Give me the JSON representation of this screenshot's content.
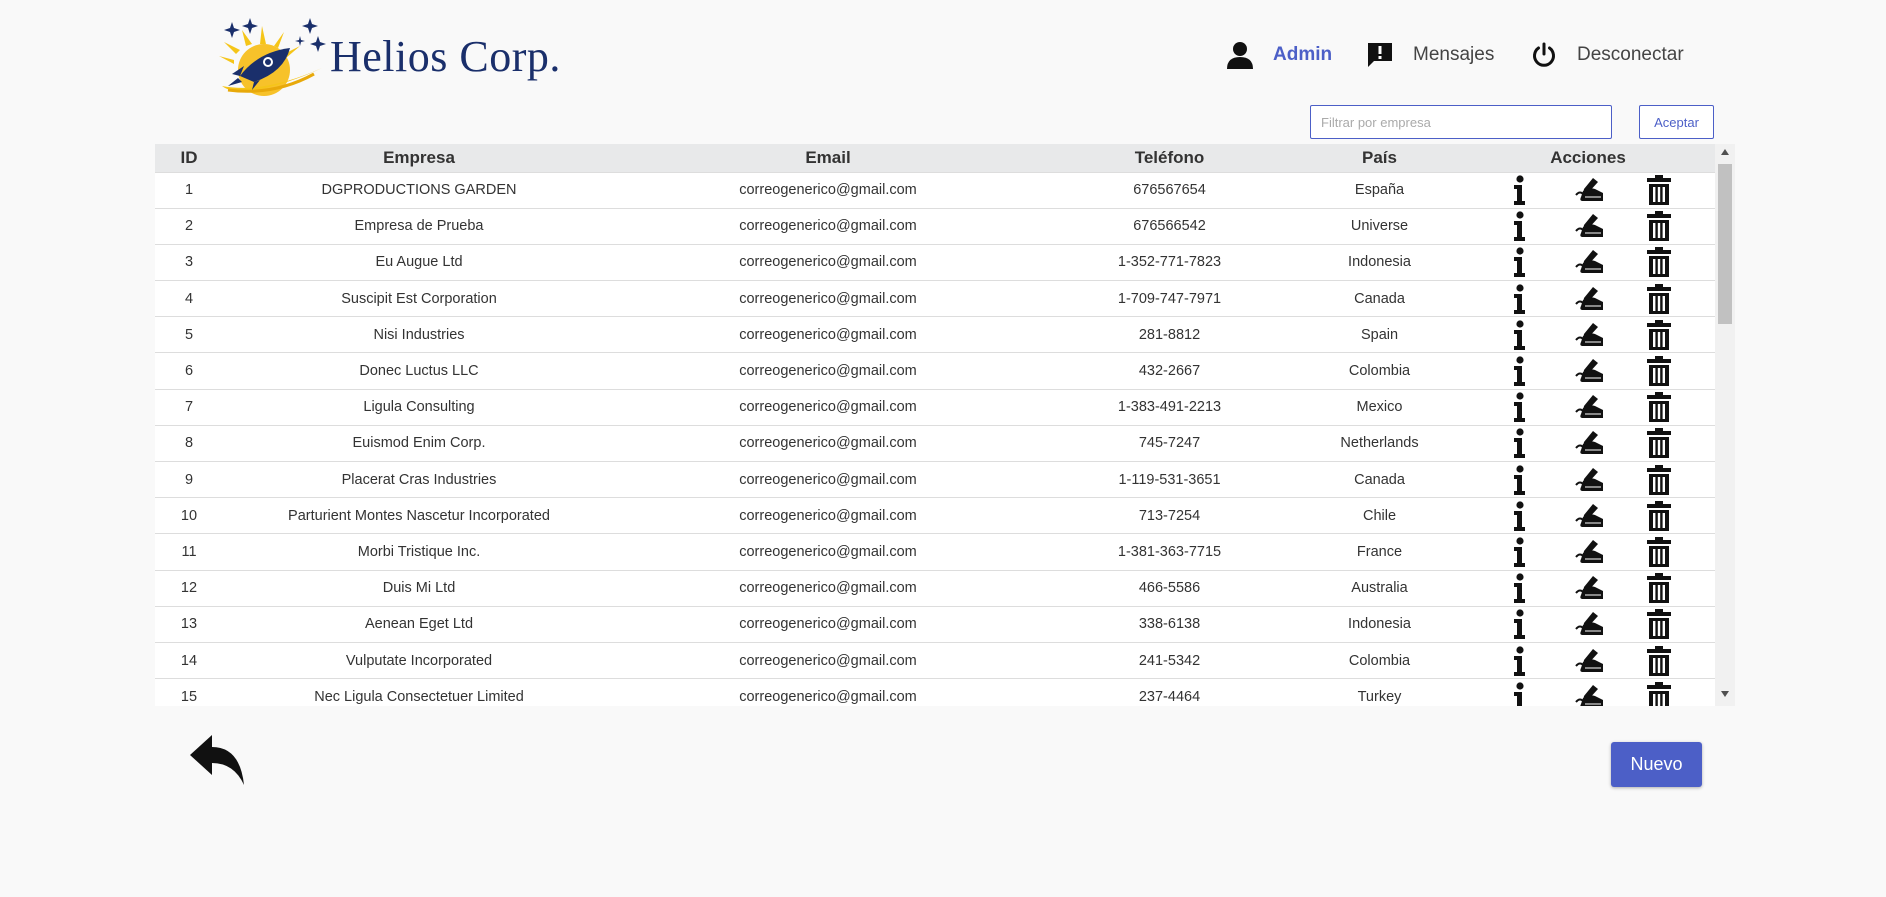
{
  "brand": {
    "name": "Helios Corp."
  },
  "nav": {
    "admin": "Admin",
    "messages": "Mensajes",
    "logout": "Desconectar"
  },
  "filter": {
    "placeholder": "Filtrar por empresa",
    "value": "",
    "accept_label": "Aceptar"
  },
  "table": {
    "columns": [
      "ID",
      "Empresa",
      "Email",
      "Teléfono",
      "País",
      "Acciones"
    ],
    "rows": [
      {
        "id": "1",
        "empresa": "DGPRODUCTIONS GARDEN",
        "email": "correogenerico@gmail.com",
        "telefono": "676567654",
        "pais": "España"
      },
      {
        "id": "2",
        "empresa": "Empresa de Prueba",
        "email": "correogenerico@gmail.com",
        "telefono": "676566542",
        "pais": "Universe"
      },
      {
        "id": "3",
        "empresa": "Eu Augue Ltd",
        "email": "correogenerico@gmail.com",
        "telefono": "1-352-771-7823",
        "pais": "Indonesia"
      },
      {
        "id": "4",
        "empresa": "Suscipit Est Corporation",
        "email": "correogenerico@gmail.com",
        "telefono": "1-709-747-7971",
        "pais": "Canada"
      },
      {
        "id": "5",
        "empresa": "Nisi Industries",
        "email": "correogenerico@gmail.com",
        "telefono": "281-8812",
        "pais": "Spain"
      },
      {
        "id": "6",
        "empresa": "Donec Luctus LLC",
        "email": "correogenerico@gmail.com",
        "telefono": "432-2667",
        "pais": "Colombia"
      },
      {
        "id": "7",
        "empresa": "Ligula Consulting",
        "email": "correogenerico@gmail.com",
        "telefono": "1-383-491-2213",
        "pais": "Mexico"
      },
      {
        "id": "8",
        "empresa": "Euismod Enim Corp.",
        "email": "correogenerico@gmail.com",
        "telefono": "745-7247",
        "pais": "Netherlands"
      },
      {
        "id": "9",
        "empresa": "Placerat Cras Industries",
        "email": "correogenerico@gmail.com",
        "telefono": "1-119-531-3651",
        "pais": "Canada"
      },
      {
        "id": "10",
        "empresa": "Parturient Montes Nascetur Incorporated",
        "email": "correogenerico@gmail.com",
        "telefono": "713-7254",
        "pais": "Chile"
      },
      {
        "id": "11",
        "empresa": "Morbi Tristique Inc.",
        "email": "correogenerico@gmail.com",
        "telefono": "1-381-363-7715",
        "pais": "France"
      },
      {
        "id": "12",
        "empresa": "Duis Mi Ltd",
        "email": "correogenerico@gmail.com",
        "telefono": "466-5586",
        "pais": "Australia"
      },
      {
        "id": "13",
        "empresa": "Aenean Eget Ltd",
        "email": "correogenerico@gmail.com",
        "telefono": "338-6138",
        "pais": "Indonesia"
      },
      {
        "id": "14",
        "empresa": "Vulputate Incorporated",
        "email": "correogenerico@gmail.com",
        "telefono": "241-5342",
        "pais": "Colombia"
      },
      {
        "id": "15",
        "empresa": "Nec Ligula Consectetuer Limited",
        "email": "correogenerico@gmail.com",
        "telefono": "237-4464",
        "pais": "Turkey"
      }
    ]
  },
  "actions": {
    "new_label": "Nuevo"
  },
  "icons": {
    "user": "user-icon",
    "messages": "message-alert-icon",
    "logout": "power-icon",
    "info": "info-icon",
    "edit": "edit-signature-icon",
    "delete": "trash-icon",
    "back": "reply-arrow-icon"
  },
  "colors": {
    "accent": "#4c5fc7",
    "brand_text": "#1a2f6b",
    "logo_yellow": "#f5c518"
  }
}
